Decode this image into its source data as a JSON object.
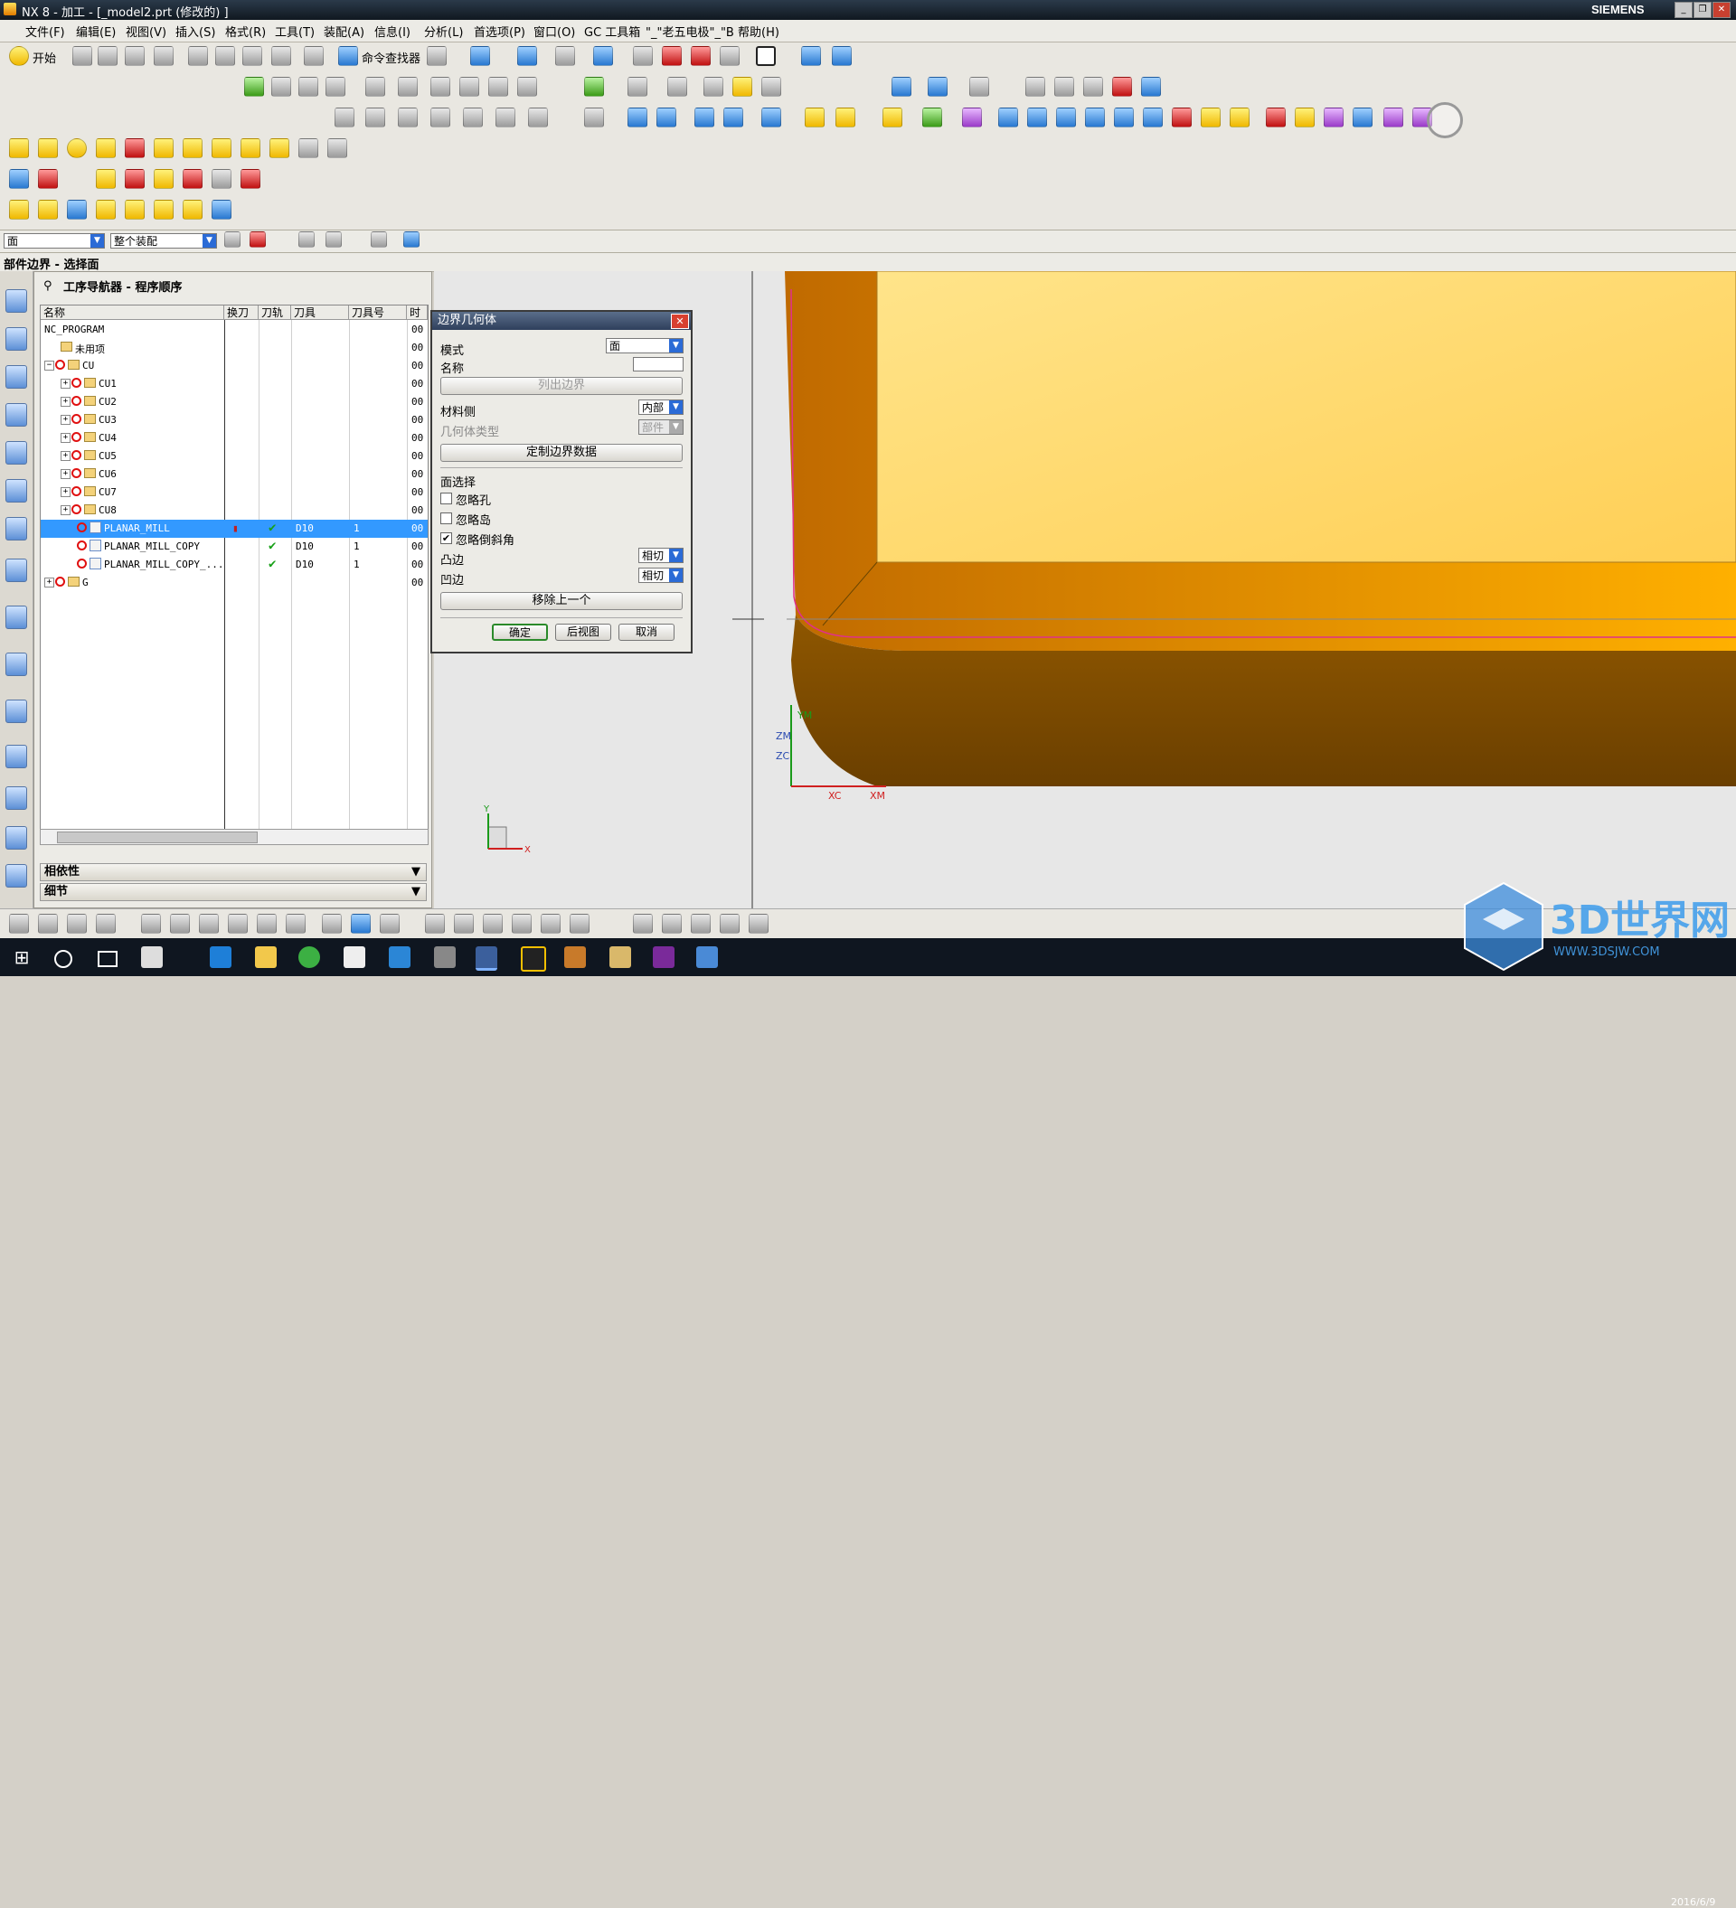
{
  "window": {
    "title": "NX 8 - 加工 - [_model2.prt (修改的) ]",
    "brand": "SIEMENS",
    "controls": [
      "_",
      "❐",
      "✕"
    ]
  },
  "menu": {
    "items": [
      "文件(F)",
      "编辑(E)",
      "视图(V)",
      "插入(S)",
      "格式(R)",
      "工具(T)",
      "装配(A)",
      "信息(I)",
      "分析(L)",
      "首选项(P)",
      "窗口(O)",
      "GC 工具箱",
      "\"_\"老五电极\"_\"B",
      "帮助(H)"
    ]
  },
  "toolbar": {
    "start_label": "开始",
    "cmd_finder_label": "命令查找器"
  },
  "selection_bar": {
    "filter_value": "面",
    "scope_value": "整个装配"
  },
  "status": {
    "prompt": "部件边界 - 选择面"
  },
  "navigator": {
    "title": "工序导航器 - 程序顺序",
    "columns": [
      "名称",
      "换刀",
      "刀轨",
      "刀具",
      "刀具号",
      "时"
    ],
    "rows": [
      {
        "indent": 0,
        "name": "NC_PROGRAM",
        "tool": "",
        "toolno": "",
        "time": "00",
        "path_ok": false,
        "toolchange": false,
        "selected": false,
        "type": "root"
      },
      {
        "indent": 1,
        "name": "未用项",
        "tool": "",
        "toolno": "",
        "time": "00",
        "path_ok": false,
        "toolchange": false,
        "selected": false,
        "type": "folder"
      },
      {
        "indent": 0,
        "name": "CU",
        "tool": "",
        "toolno": "",
        "time": "00",
        "path_ok": false,
        "toolchange": false,
        "selected": false,
        "type": "group"
      },
      {
        "indent": 1,
        "name": "CU1",
        "tool": "",
        "toolno": "",
        "time": "00",
        "path_ok": false,
        "toolchange": false,
        "selected": false,
        "type": "group"
      },
      {
        "indent": 1,
        "name": "CU2",
        "tool": "",
        "toolno": "",
        "time": "00",
        "path_ok": false,
        "toolchange": false,
        "selected": false,
        "type": "group"
      },
      {
        "indent": 1,
        "name": "CU3",
        "tool": "",
        "toolno": "",
        "time": "00",
        "path_ok": false,
        "toolchange": false,
        "selected": false,
        "type": "group"
      },
      {
        "indent": 1,
        "name": "CU4",
        "tool": "",
        "toolno": "",
        "time": "00",
        "path_ok": false,
        "toolchange": false,
        "selected": false,
        "type": "group"
      },
      {
        "indent": 1,
        "name": "CU5",
        "tool": "",
        "toolno": "",
        "time": "00",
        "path_ok": false,
        "toolchange": false,
        "selected": false,
        "type": "group"
      },
      {
        "indent": 1,
        "name": "CU6",
        "tool": "",
        "toolno": "",
        "time": "00",
        "path_ok": false,
        "toolchange": false,
        "selected": false,
        "type": "group"
      },
      {
        "indent": 1,
        "name": "CU7",
        "tool": "",
        "toolno": "",
        "time": "00",
        "path_ok": false,
        "toolchange": false,
        "selected": false,
        "type": "group"
      },
      {
        "indent": 1,
        "name": "CU8",
        "tool": "",
        "toolno": "",
        "time": "00",
        "path_ok": false,
        "toolchange": false,
        "selected": false,
        "type": "group"
      },
      {
        "indent": 2,
        "name": "PLANAR_MILL",
        "tool": "D10",
        "toolno": "1",
        "time": "00",
        "path_ok": true,
        "toolchange": true,
        "selected": true,
        "type": "op"
      },
      {
        "indent": 2,
        "name": "PLANAR_MILL_COPY",
        "tool": "D10",
        "toolno": "1",
        "time": "00",
        "path_ok": true,
        "toolchange": false,
        "selected": false,
        "type": "op"
      },
      {
        "indent": 2,
        "name": "PLANAR_MILL_COPY_...",
        "tool": "D10",
        "toolno": "1",
        "time": "00",
        "path_ok": true,
        "toolchange": false,
        "selected": false,
        "type": "op"
      },
      {
        "indent": 0,
        "name": "G",
        "tool": "",
        "toolno": "",
        "time": "00",
        "path_ok": false,
        "toolchange": false,
        "selected": false,
        "type": "group"
      }
    ],
    "panels": [
      "相依性",
      "细节"
    ]
  },
  "dialog": {
    "title": "边界几何体",
    "mode_label": "模式",
    "mode_value": "面",
    "name_label": "名称",
    "name_value": "",
    "list_boundary_button": "列出边界",
    "material_side_label": "材料侧",
    "material_side_value": "内部",
    "geometry_type_label": "几何体类型",
    "geometry_type_value": "部件",
    "custom_boundary_button": "定制边界数据",
    "face_select_label": "面选择",
    "ignore_holes_label": "忽略孔",
    "ignore_holes": false,
    "ignore_islands_label": "忽略岛",
    "ignore_islands": false,
    "ignore_chamfers_label": "忽略倒斜角",
    "ignore_chamfers": true,
    "convex_label": "凸边",
    "convex_value": "相切",
    "concave_label": "凹边",
    "concave_value": "相切",
    "remove_last_button": "移除上一个",
    "ok_button": "确定",
    "back_button": "后视图",
    "cancel_button": "取消"
  },
  "viewport": {
    "axis_labels": {
      "ym": "YM",
      "zm": "ZM",
      "zc": "ZC",
      "xc": "XC",
      "xm": "XM"
    },
    "triad_labels": {
      "y": "Y",
      "x": "X"
    }
  },
  "taskbar": {
    "clock_date": "2016/6/9"
  },
  "watermark": {
    "text": "3D世界网",
    "url": "WWW.3DSJW.COM"
  },
  "colors": {
    "part_top": "#ffd966",
    "part_side": "#7a4a00",
    "selection": "#3399ff",
    "dialog_title": "#2f3f5c"
  }
}
